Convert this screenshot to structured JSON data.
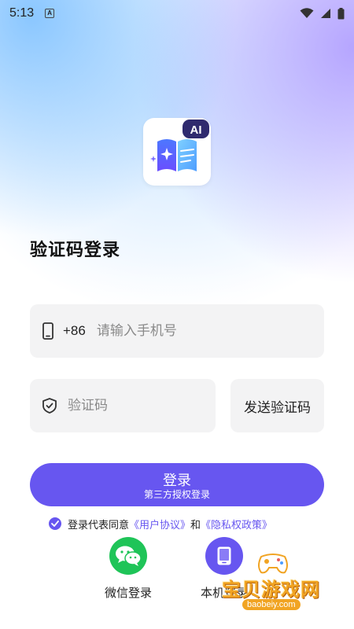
{
  "status_bar": {
    "time": "5:13",
    "indicator": "A"
  },
  "logo": {
    "badge_text": "AI"
  },
  "page": {
    "title": "验证码登录"
  },
  "phone": {
    "prefix": "+86",
    "placeholder": "请输入手机号"
  },
  "code": {
    "placeholder": "验证码",
    "send_label": "发送验证码"
  },
  "login_button": {
    "label": "登录",
    "sub_label": "第三方授权登录"
  },
  "agreement": {
    "prefix": "登录代表同意",
    "user_agreement": "《用户协议》",
    "and": "和",
    "privacy_policy": "《隐私权政策》",
    "checked": true
  },
  "alt_logins": {
    "wechat_label": "微信登录",
    "local_label": "本机登录"
  },
  "watermark": {
    "text": "宝贝游戏网",
    "url": "baobeiy.com"
  },
  "colors": {
    "accent": "#6756f0",
    "wechat": "#1fc458",
    "field_bg": "#f3f3f4"
  },
  "icons": [
    "phone-icon",
    "shield-icon",
    "wechat-icon",
    "tablet-icon",
    "wifi-icon",
    "signal-icon",
    "battery-icon",
    "check-icon",
    "book-icon",
    "sparkle-icon"
  ]
}
